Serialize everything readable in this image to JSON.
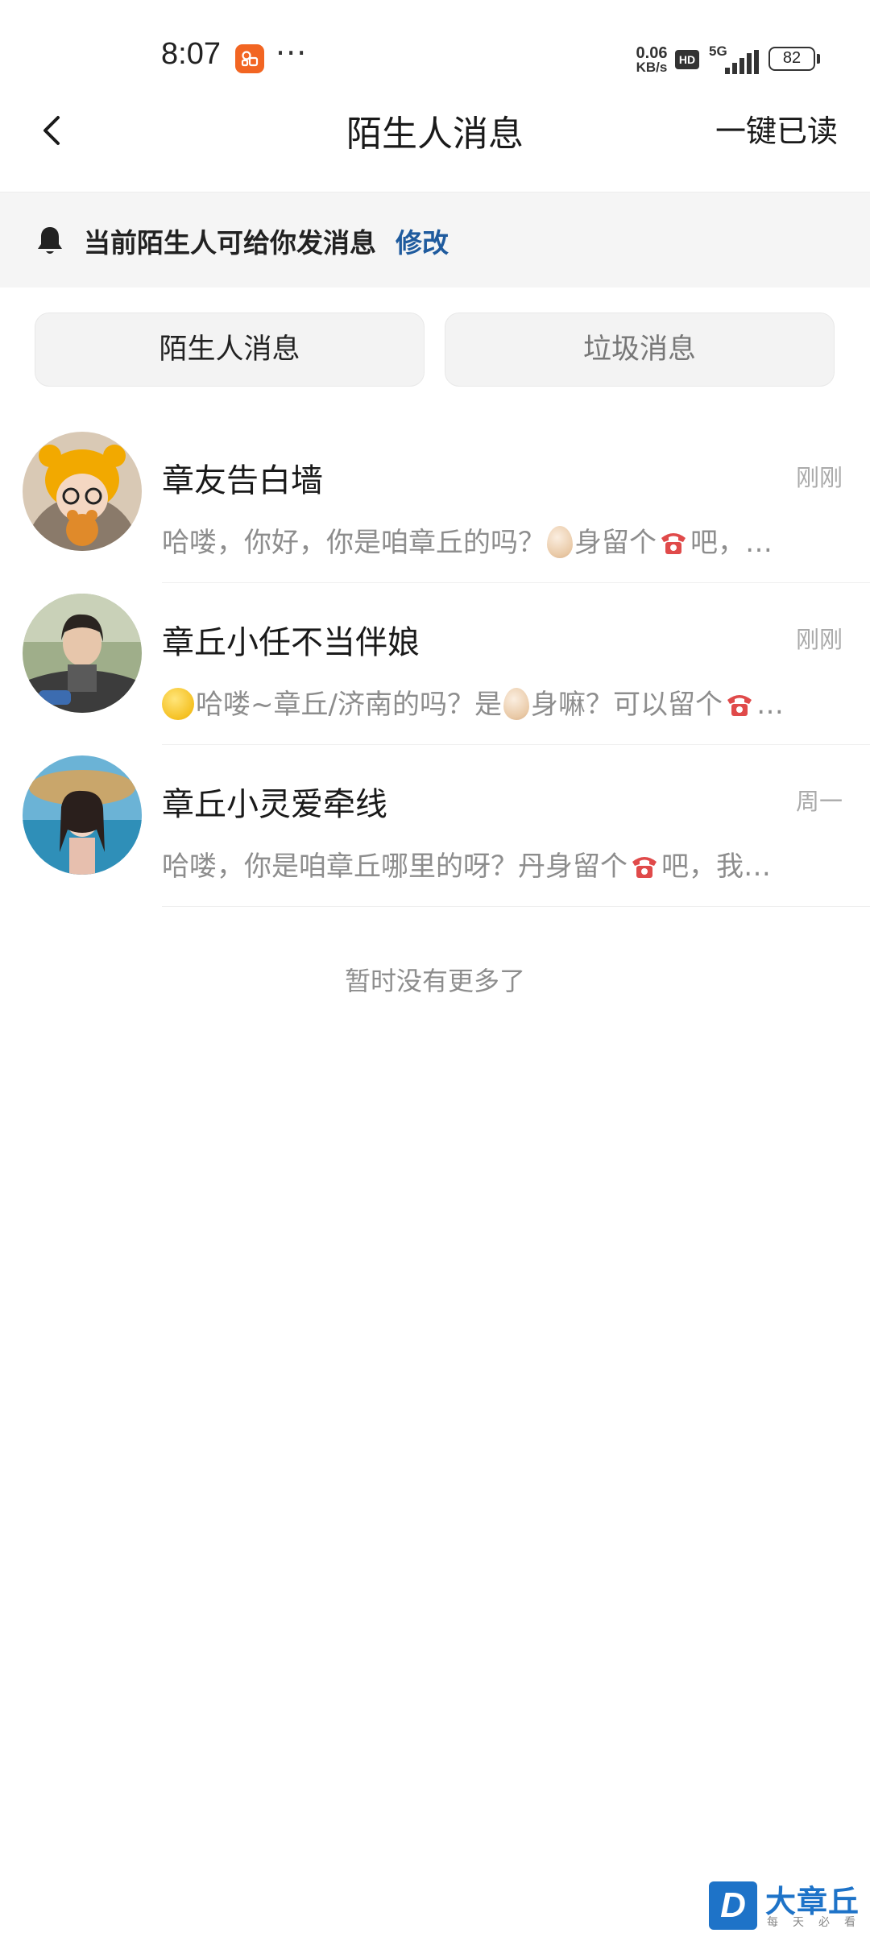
{
  "status_bar": {
    "time": "8:07",
    "dots": "···",
    "speed_value": "0.06",
    "speed_unit": "KB/s",
    "hd": "HD",
    "network": "5G",
    "battery": "82",
    "app_icon": "orange-chat-app-icon"
  },
  "nav": {
    "back_icon": "chevron-left-icon",
    "title": "陌生人消息",
    "action": "一键已读"
  },
  "notice": {
    "icon": "bell-icon",
    "text": "当前陌生人可给你发消息",
    "link": "修改"
  },
  "tabs": [
    {
      "label": "陌生人消息",
      "active": true
    },
    {
      "label": "垃圾消息",
      "active": false
    }
  ],
  "messages": [
    {
      "name": "章友告白墙",
      "time": "刚刚",
      "preview": {
        "lead": "",
        "a": "哈喽，你好，你是咱章丘的吗？",
        "b": "身留个",
        "c": "吧，…"
      }
    },
    {
      "name": "章丘小任不当伴娘",
      "time": "刚刚",
      "preview": {
        "lead": "thinking-face-emoji",
        "a": "哈喽~章丘/济南的吗？是",
        "b": "身嘛？可以留个",
        "c": "…"
      }
    },
    {
      "name": "章丘小灵爱牵线",
      "time": "周一",
      "preview": {
        "a": "哈喽，你是咱章丘哪里的呀？丹身留个",
        "c": "吧，我…"
      }
    }
  ],
  "end_hint": "暂时没有更多了",
  "watermark": {
    "logo": "D",
    "name": "大章丘",
    "sub": "每天必看"
  },
  "colors": {
    "accent_link": "#1f5b9e",
    "notice_bg": "#f5f5f5",
    "tab_bg": "#f3f3f3",
    "muted_text": "#8d8d8d"
  }
}
